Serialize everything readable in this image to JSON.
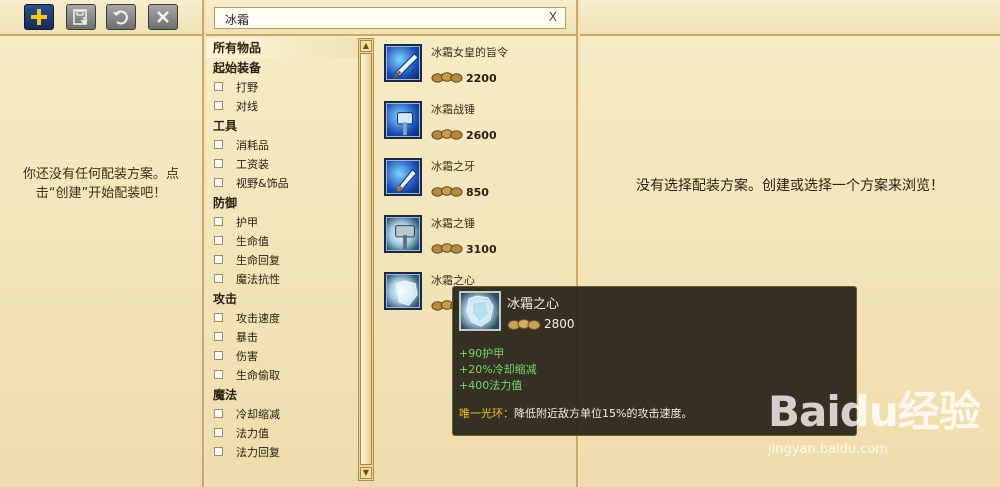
{
  "left": {
    "empty_message": "你还没有任何配装方案。点击“创建”开始配装吧！"
  },
  "search": {
    "value": "冰霜",
    "clear_label": "X"
  },
  "categories": [
    {
      "label": "所有物品",
      "type": "header",
      "selected": true
    },
    {
      "label": "起始装备",
      "type": "header"
    },
    {
      "label": "打野",
      "type": "item"
    },
    {
      "label": "对线",
      "type": "item"
    },
    {
      "label": "工具",
      "type": "header"
    },
    {
      "label": "消耗品",
      "type": "item"
    },
    {
      "label": "工资装",
      "type": "item"
    },
    {
      "label": "视野&饰品",
      "type": "item"
    },
    {
      "label": "防御",
      "type": "header"
    },
    {
      "label": "护甲",
      "type": "item"
    },
    {
      "label": "生命值",
      "type": "item"
    },
    {
      "label": "生命回复",
      "type": "item"
    },
    {
      "label": "魔法抗性",
      "type": "item"
    },
    {
      "label": "攻击",
      "type": "header"
    },
    {
      "label": "攻击速度",
      "type": "item"
    },
    {
      "label": "暴击",
      "type": "item"
    },
    {
      "label": "伤害",
      "type": "item"
    },
    {
      "label": "生命偷取",
      "type": "item"
    },
    {
      "label": "魔法",
      "type": "header"
    },
    {
      "label": "冷却缩减",
      "type": "item"
    },
    {
      "label": "法力值",
      "type": "item"
    },
    {
      "label": "法力回复",
      "type": "item"
    }
  ],
  "items": [
    {
      "name": "冰霜女皇的旨令",
      "price": "2200",
      "icon": "frost-queen-blade-icon"
    },
    {
      "name": "冰霜战锤",
      "price": "2600",
      "icon": "frozen-mallet-icon"
    },
    {
      "name": "冰霜之牙",
      "price": "850",
      "icon": "frostfang-icon"
    },
    {
      "name": "冰霜之锤",
      "price": "3100",
      "icon": "frost-hammer-icon"
    },
    {
      "name": "冰霜之心",
      "price": "",
      "icon": "frozen-heart-icon"
    }
  ],
  "tooltip": {
    "title": "冰霜之心",
    "price": "2800",
    "stats": [
      "+90护甲",
      "+20%冷却缩减",
      "+400法力值"
    ],
    "passive_label": "唯一光环：",
    "passive_text": "降低附近敌方单位15%的攻击速度。"
  },
  "right": {
    "empty_message": "没有选择配装方案。创建或选择一个方案来浏览！"
  },
  "watermark": {
    "brand": "Baidu经验",
    "url": "jingyan.baidu.com"
  },
  "colors": {
    "parchment": "#f1e3b6",
    "stat_green": "#79d671",
    "passive_gold": "#f3c12c",
    "tooltip_bg": "#262219"
  }
}
